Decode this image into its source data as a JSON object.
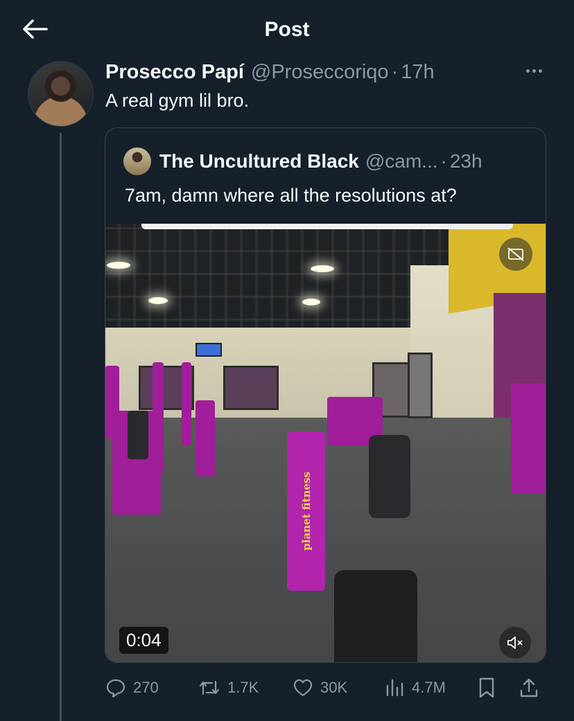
{
  "header": {
    "title": "Post"
  },
  "post": {
    "author_name": "Prosecco Papí",
    "author_handle": "@Proseccoriqo",
    "separator": "·",
    "time": "17h",
    "text": "A real gym lil bro."
  },
  "quote": {
    "author_name": "The Uncultured Black",
    "author_handle": "@cam...",
    "separator": "·",
    "time": "23h",
    "text": "7am, damn where all the resolutions at?",
    "video": {
      "duration": "0:04",
      "brand_text": "planet fitness"
    }
  },
  "actions": {
    "replies": "270",
    "reposts": "1.7K",
    "likes": "30K",
    "views": "4.7M"
  },
  "colors": {
    "background": "#15202b",
    "secondary_text": "#8b98a5",
    "border": "#38444d"
  },
  "icons": [
    "back-arrow-icon",
    "more-icon",
    "captions-off-icon",
    "muted-speaker-icon",
    "reply-icon",
    "repost-icon",
    "like-icon",
    "views-icon",
    "bookmark-icon",
    "share-icon"
  ]
}
